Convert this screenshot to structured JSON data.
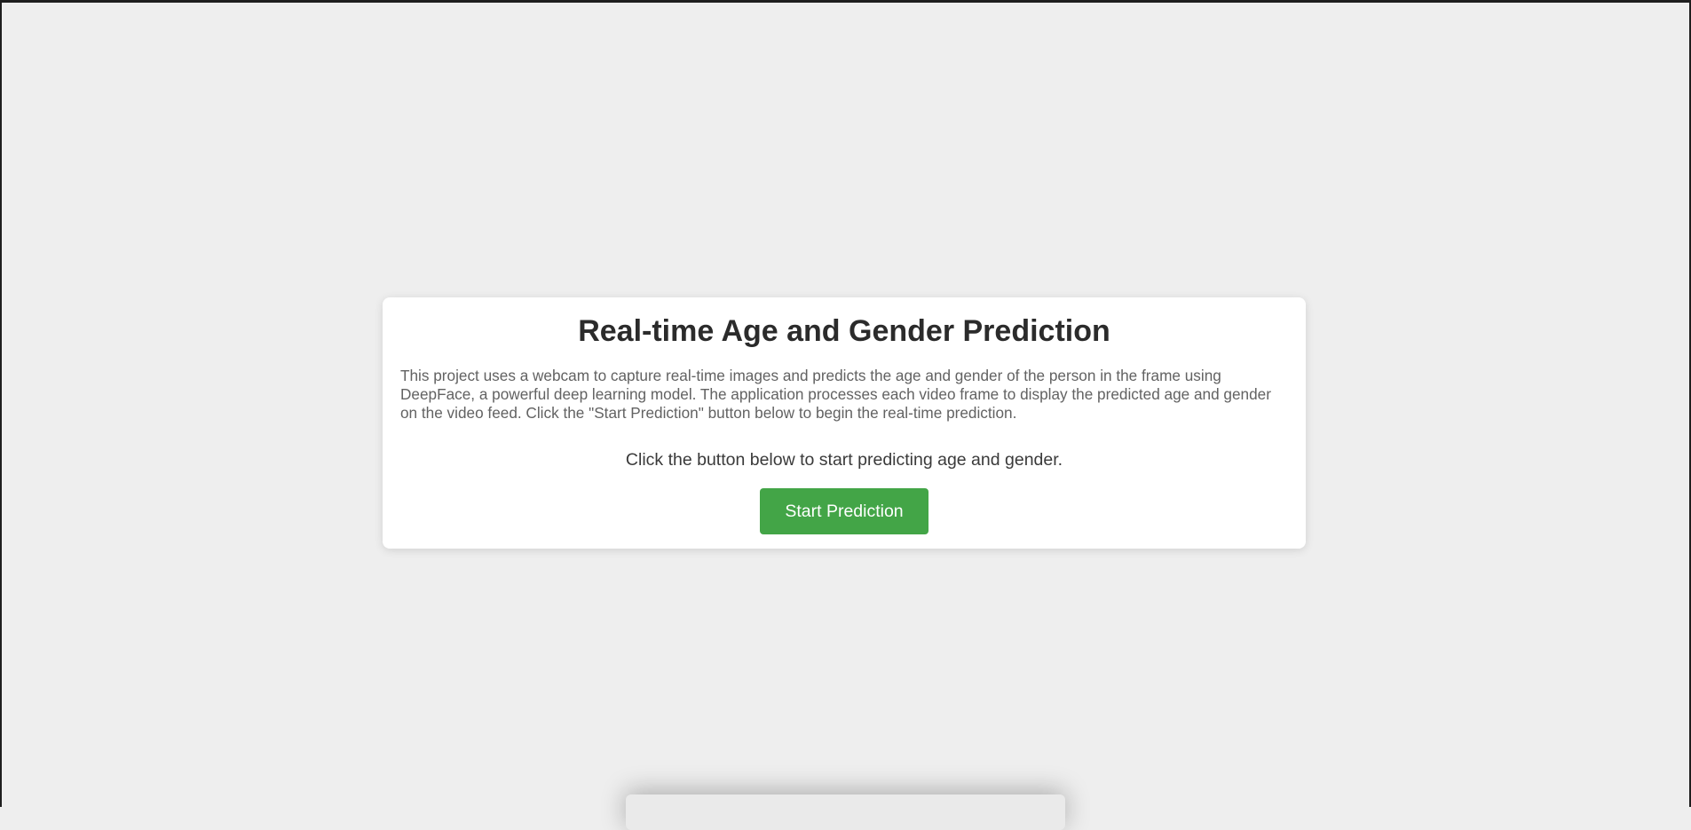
{
  "card": {
    "title": "Real-time Age and Gender Prediction",
    "description": "This project uses a webcam to capture real-time images and predicts the age and gender of the person in the frame using DeepFace, a powerful deep learning model. The application processes each video frame to display the predicted age and gender on the video feed. Click the \"Start Prediction\" button below to begin the real-time prediction.",
    "prompt": "Click the button below to start predicting age and gender.",
    "start_button_label": "Start Prediction"
  },
  "colors": {
    "page_background": "#eeeeee",
    "card_background": "#ffffff",
    "button_background": "#43a547",
    "button_text": "#ffffff",
    "title_text": "#2b2b2b"
  }
}
